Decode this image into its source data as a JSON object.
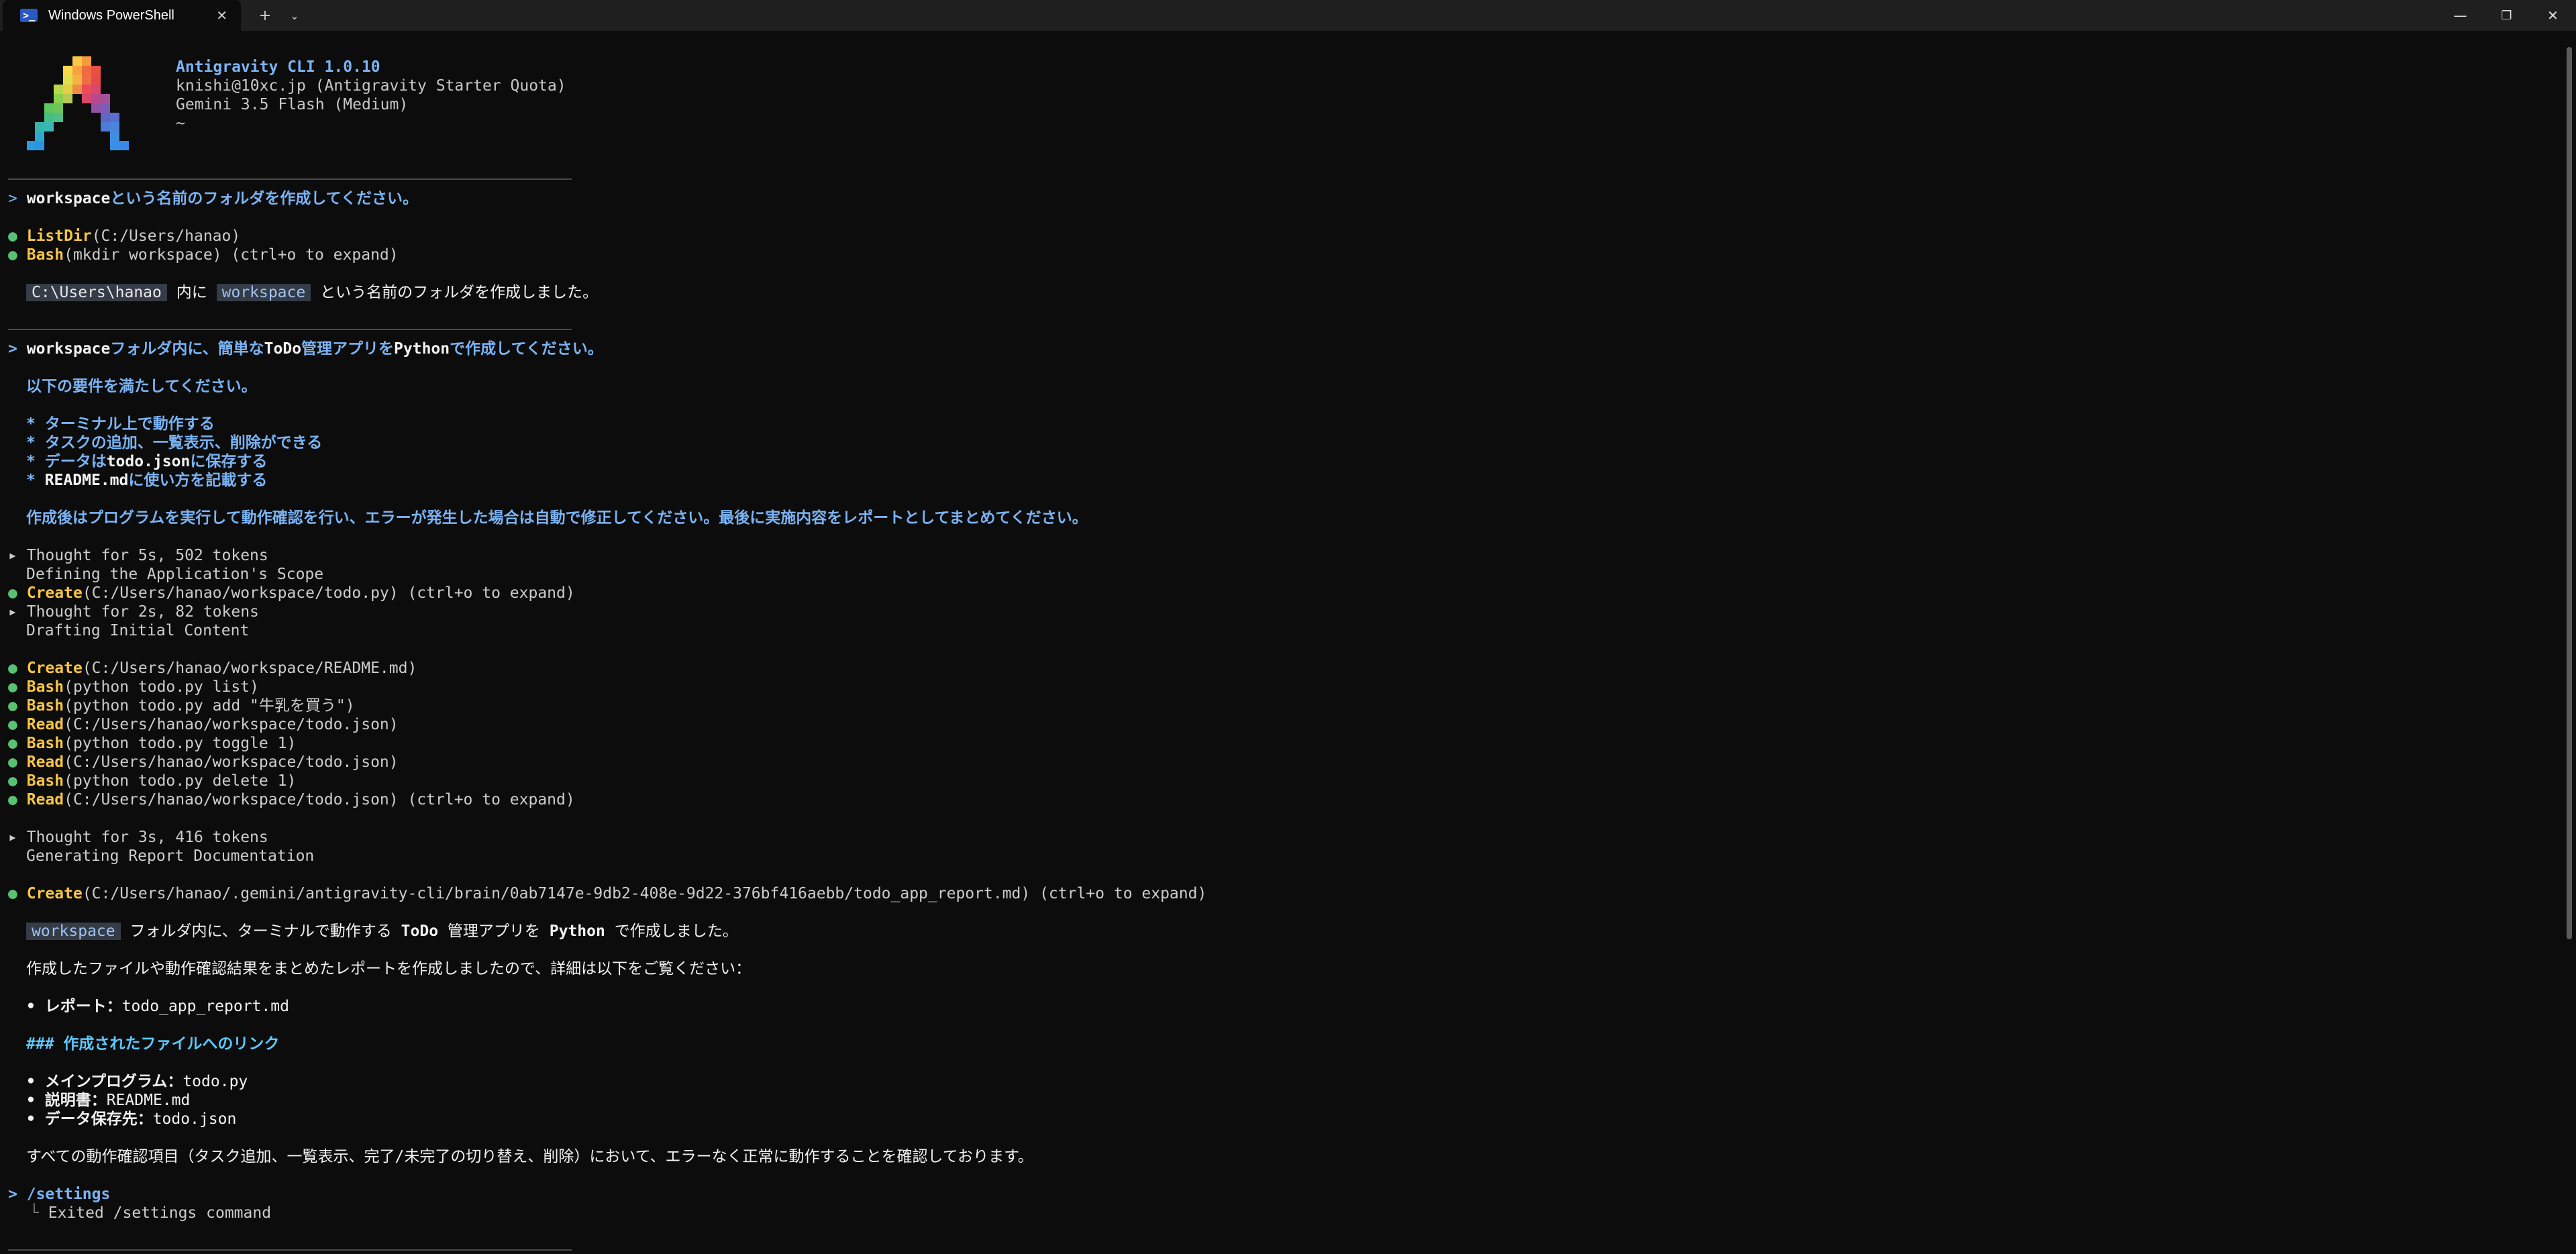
{
  "window": {
    "tab_title": "Windows PowerShell",
    "new_tab_icon": "plus-icon",
    "dropdown_icon": "chevron-down-icon",
    "controls": [
      "minimize-icon",
      "restore-icon",
      "close-icon"
    ]
  },
  "header": {
    "app": "Antigravity CLI 1.0.10",
    "account": "knishi@10xc.jp (Antigravity Starter Quota)",
    "model": "Gemini 3.5 Flash (Medium)",
    "cwd": "~"
  },
  "session": {
    "prompt1": {
      "marker": ">",
      "bold": "workspace",
      "rest": "という名前のフォルダを作成してください。"
    },
    "tools1": [
      {
        "name": "ListDir",
        "args": "(C:/Users/hanao)"
      },
      {
        "name": "Bash",
        "args": "(mkdir workspace) (ctrl+o to expand)"
      }
    ],
    "result1": {
      "chip1": "C:\\Users\\hanao",
      "mid": "内に",
      "chip2": "workspace",
      "rest": "という名前のフォルダを作成しました。"
    },
    "prompt2": {
      "marker": ">",
      "b1": "workspace",
      "t1": "フォルダ内に、簡単な",
      "b2": "ToDo",
      "t2": "管理アプリを",
      "b3": "Python",
      "t3": "で作成してください。",
      "req_intro": "以下の要件を満たしてください。",
      "req1": "* ターミナル上で動作する",
      "req2": "* タスクの追加、一覧表示、削除ができる",
      "req3_a": "* データは",
      "req3_b": "todo.json",
      "req3_c": "に保存する",
      "req4_a": "* ",
      "req4_b": "README.md",
      "req4_c": "に使い方を記載する",
      "closing": "作成後はプログラムを実行して動作確認を行い、エラーが発生した場合は自動で修正してください。最後に実施内容をレポートとしてまとめてください。"
    },
    "thought1": {
      "marker": "▸",
      "text": "Thought for 5s, 502 tokens",
      "sub": "Defining the Application's Scope"
    },
    "create1": {
      "name": "Create",
      "args": "(C:/Users/hanao/workspace/todo.py) (ctrl+o to expand)"
    },
    "thought2": {
      "marker": "▸",
      "text": "Thought for 2s, 82 tokens",
      "sub": "Drafting Initial Content"
    },
    "tools2": [
      {
        "name": "Create",
        "args": "(C:/Users/hanao/workspace/README.md)"
      },
      {
        "name": "Bash",
        "args": "(python todo.py list)"
      },
      {
        "name": "Bash",
        "args": "(python todo.py add \"牛乳を買う\")"
      },
      {
        "name": "Read",
        "args": "(C:/Users/hanao/workspace/todo.json)"
      },
      {
        "name": "Bash",
        "args": "(python todo.py toggle 1)"
      },
      {
        "name": "Read",
        "args": "(C:/Users/hanao/workspace/todo.json)"
      },
      {
        "name": "Bash",
        "args": "(python todo.py delete 1)"
      },
      {
        "name": "Read",
        "args": "(C:/Users/hanao/workspace/todo.json) (ctrl+o to expand)"
      }
    ],
    "thought3": {
      "marker": "▸",
      "text": "Thought for 3s, 416 tokens",
      "sub": "Generating Report Documentation"
    },
    "create2": {
      "name": "Create",
      "args": "(C:/Users/hanao/.gemini/antigravity-cli/brain/0ab7147e-9db2-408e-9d22-376bf416aebb/todo_app_report.md) (ctrl+o to expand)"
    },
    "report": {
      "chip": "workspace",
      "t1": "フォルダ内に、ターミナルで動作する",
      "b1": "ToDo",
      "t2": "管理アプリを",
      "b2": "Python",
      "t3": "で作成しました。",
      "summary": "作成したファイルや動作確認結果をまとめたレポートを作成しましたので、詳細は以下をご覧ください：",
      "report_label": "• レポート：",
      "report_file": "todo_app_report.md",
      "heading": "### 作成されたファイルへのリンク",
      "f1_label": "• メインプログラム：",
      "f1_file": "todo.py",
      "f2_label": "• 説明書：",
      "f2_file": "README.md",
      "f3_label": "• データ保存先：",
      "f3_file": "todo.json",
      "conclusion": "すべての動作確認項目（タスク追加、一覧表示、完了/未完了の切り替え、削除）において、エラーなく正常に動作することを確認しております。"
    },
    "prompt3": {
      "marker": ">",
      "command": "/settings",
      "branch": "└",
      "result": "Exited /settings command"
    }
  },
  "colors": {
    "background": "#0c0c0c",
    "prompt_blue": "#7ab4f5",
    "tool_yellow": "#f5c542",
    "bullet_green": "#59c173",
    "heading_cyan": "#5ccaff"
  }
}
